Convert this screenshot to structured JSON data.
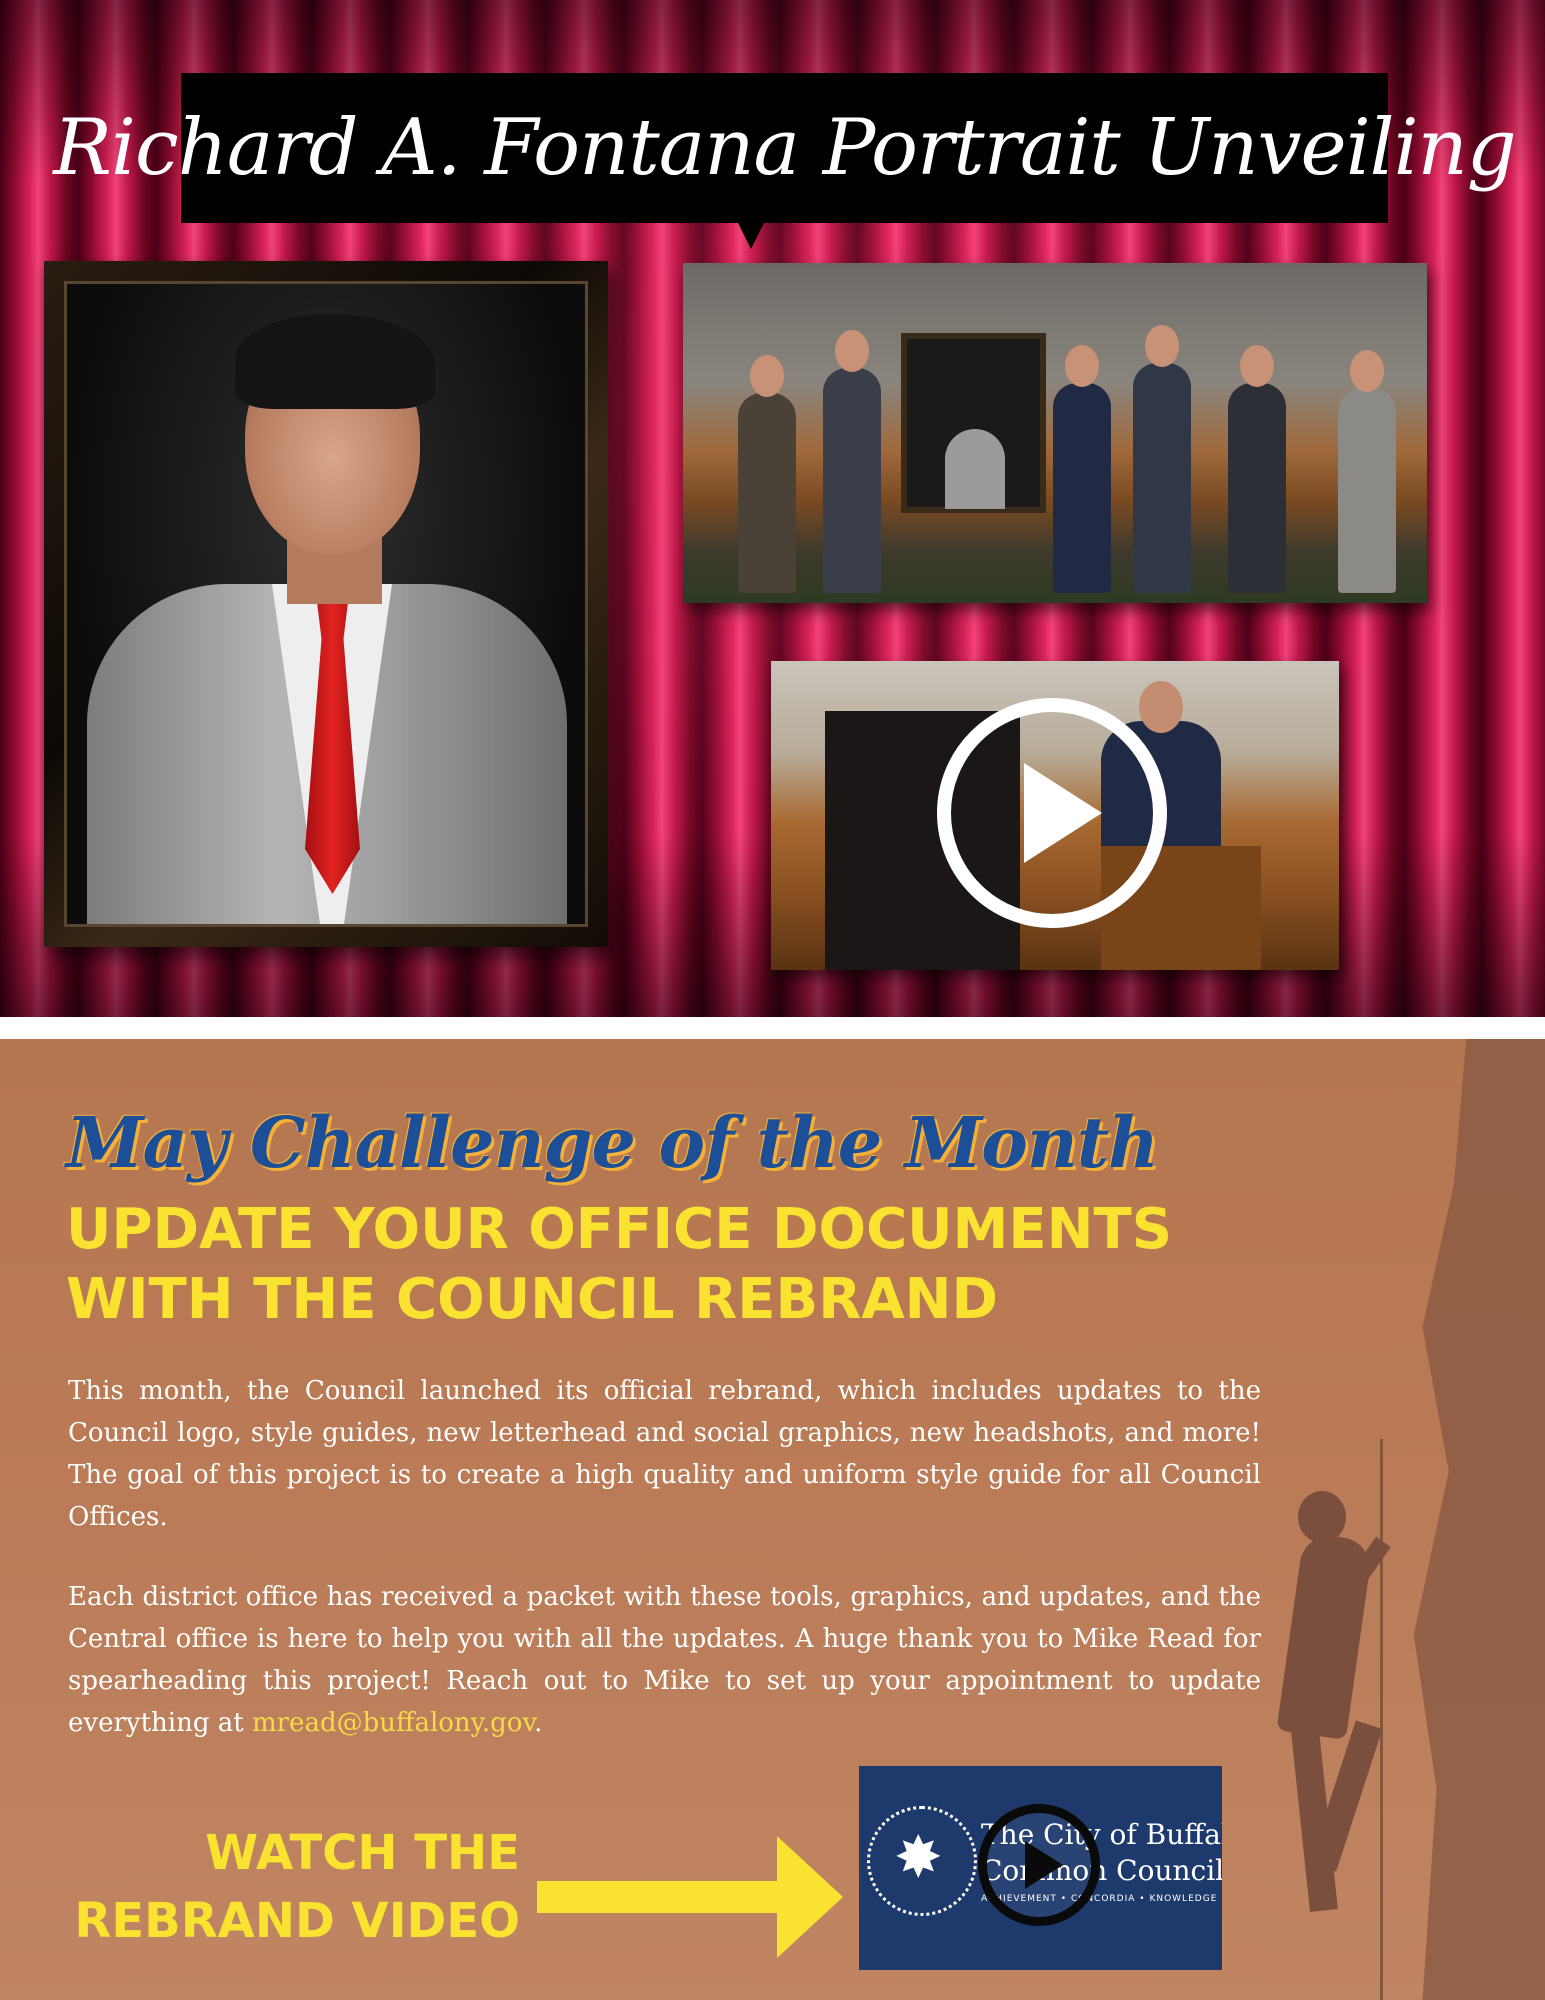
{
  "page": {
    "title": "Richard A. Fontana Portrait Unveiling"
  },
  "challenge": {
    "heading": "May Challenge of the Month",
    "subheading_line1": "UPDATE YOUR OFFICE DOCUMENTS",
    "subheading_line2": "WITH THE COUNCIL REBRAND",
    "paragraph1": "This month, the Council launched its official rebrand, which includes updates to the Council logo, style guides, new letterhead and social graphics, new headshots, and more!  The goal of this project is to create a high quality and uniform style guide for all Council Offices.",
    "paragraph2_prefix": "Each district office has received a packet with these tools, graphics, and updates, and the Central office is here to help you with all the updates.  A huge thank you to Mike Read for spearheading this project!  Reach out to Mike to set up your appointment to update everything at ",
    "email": "mread@buffalony.gov",
    "paragraph2_suffix": "."
  },
  "cta": {
    "line1": "WATCH THE",
    "line2": "REBRAND VIDEO"
  },
  "video_thumb": {
    "line1": "The City of Buffalo",
    "line2": "Common Council",
    "motto": "ACHIEVEMENT  •  CONCORDIA  •  KNOWLEDGE"
  },
  "colors": {
    "accent_yellow": "#f9e230",
    "heading_blue": "#1c4f97",
    "curtain_red": "#c2184c",
    "lower_bg": "#b97a55"
  },
  "icons": [
    "play-icon",
    "arrow-right-icon",
    "city-seal-icon"
  ]
}
